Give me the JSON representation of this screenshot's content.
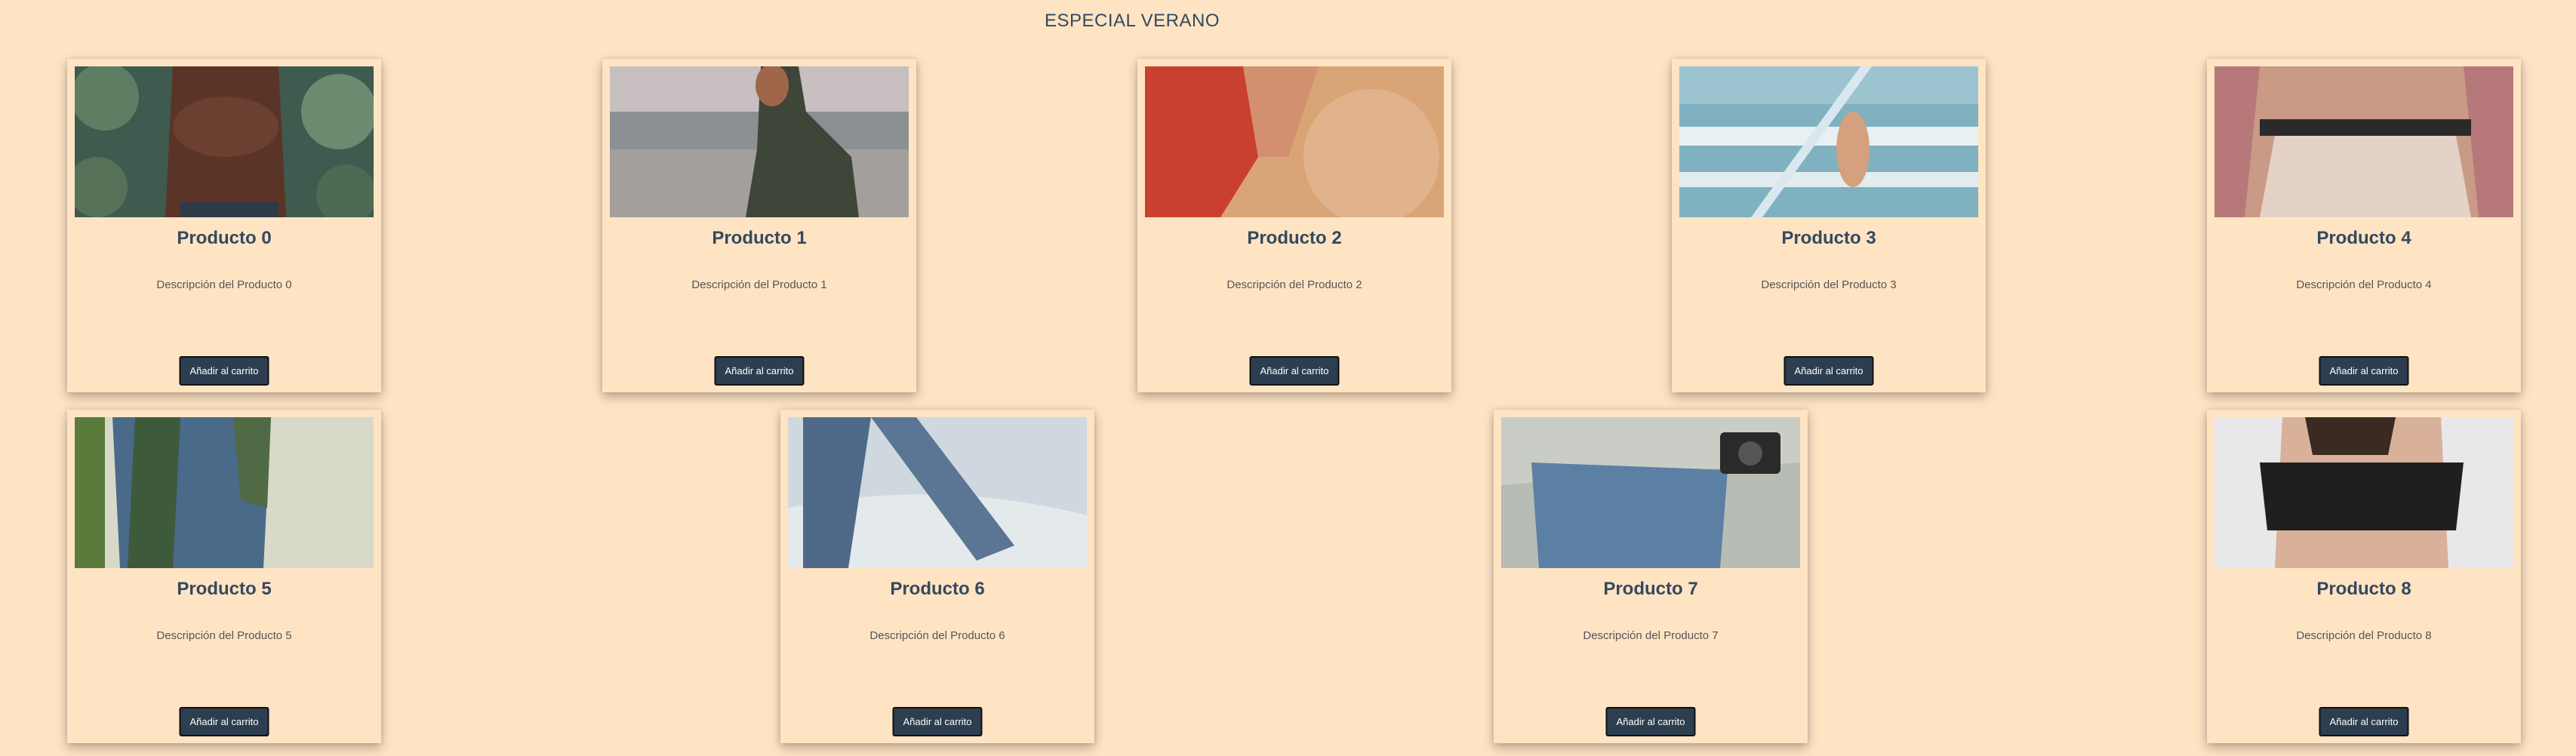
{
  "page": {
    "title": "ESPECIAL VERANO"
  },
  "products": [
    {
      "name": "Producto 0",
      "description": "Descripción del Producto 0",
      "button": "Añadir al carrito"
    },
    {
      "name": "Producto 1",
      "description": "Descripción del Producto 1",
      "button": "Añadir al carrito"
    },
    {
      "name": "Producto 2",
      "description": "Descripción del Producto 2",
      "button": "Añadir al carrito"
    },
    {
      "name": "Producto 3",
      "description": "Descripción del Producto 3",
      "button": "Añadir al carrito"
    },
    {
      "name": "Producto 4",
      "description": "Descripción del Producto 4",
      "button": "Añadir al carrito"
    },
    {
      "name": "Producto 5",
      "description": "Descripción del Producto 5",
      "button": "Añadir al carrito"
    },
    {
      "name": "Producto 6",
      "description": "Descripción del Producto 6",
      "button": "Añadir al carrito"
    },
    {
      "name": "Producto 7",
      "description": "Descripción del Producto 7",
      "button": "Añadir al carrito"
    },
    {
      "name": "Producto 8",
      "description": "Descripción del Producto 8",
      "button": "Añadir al carrito"
    }
  ],
  "colors": {
    "background": "#ffe4c4",
    "title": "#34495e",
    "button": "#2c3e50",
    "button_text": "#ffffff"
  }
}
